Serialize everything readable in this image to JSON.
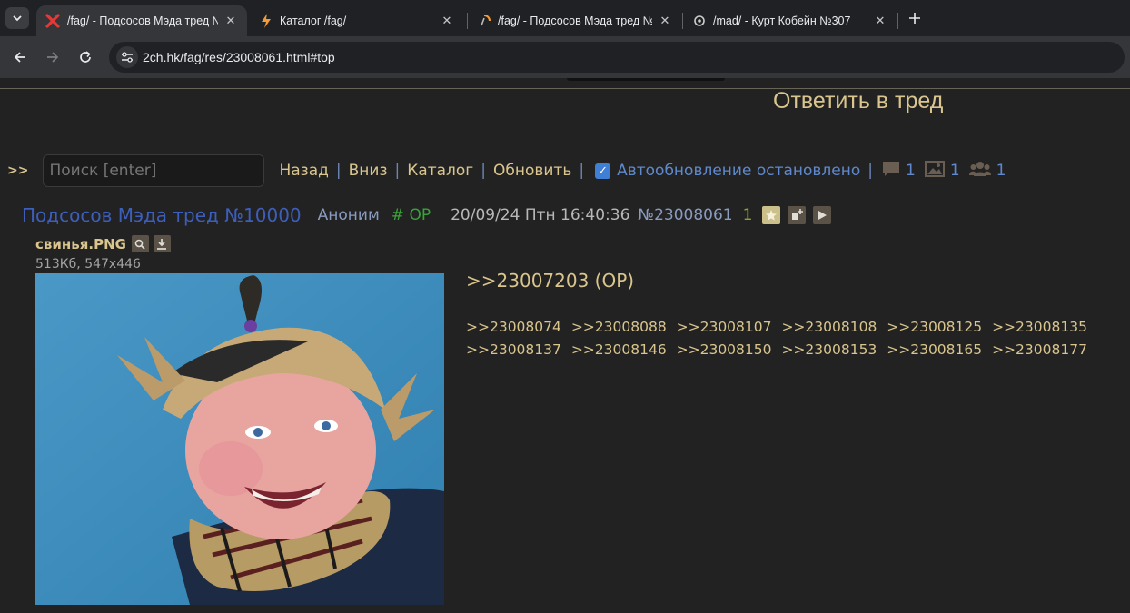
{
  "browser": {
    "tabs": [
      {
        "title": "/fag/ - Подсосов Мэда тред №",
        "icon": "red-x-icon",
        "active": true
      },
      {
        "title": "Каталог /fag/",
        "icon": "lightning-icon",
        "active": false
      },
      {
        "title": "/fag/ - Подсосов Мэда тред №",
        "icon": "loading-icon",
        "active": false
      },
      {
        "title": "/mad/ - Курт Кобейн №307",
        "icon": "compass-icon",
        "active": false
      }
    ],
    "url": "2ch.hk/fag/res/23008061.html#top"
  },
  "page": {
    "reply_thread": "Ответить в тред",
    "nav": {
      "arrows": ">>",
      "search_placeholder": "Поиск [enter]",
      "back": "Назад",
      "down": "Вниз",
      "catalog": "Каталог",
      "refresh": "Обновить",
      "autoupdate": "Автообновление остановлено",
      "autoupdate_checked": true,
      "posts_count": "1",
      "images_count": "1",
      "posters_count": "1"
    },
    "post": {
      "subject": "Подсосов Мэда тред №10000",
      "author": "Аноним",
      "trip": "# OP",
      "date": "20/09/24 Птн 16:40:36",
      "number": "№23008061",
      "count": "1",
      "file_name": "свинья.PNG",
      "file_meta": "513Кб, 547x446",
      "quote_op": ">>23007203 (OP)",
      "replies": [
        ">>23008074",
        ">>23008088",
        ">>23008107",
        ">>23008108",
        ">>23008125",
        ">>23008135",
        ">>23008137",
        ">>23008146",
        ">>23008150",
        ">>23008153",
        ">>23008165",
        ">>23008177"
      ]
    }
  },
  "colors": {
    "background": "#222222",
    "accent_text": "#d9c58d",
    "link_blue": "#5f89cc",
    "subject_blue": "#3d5fbb",
    "trip_green": "#39a339"
  }
}
